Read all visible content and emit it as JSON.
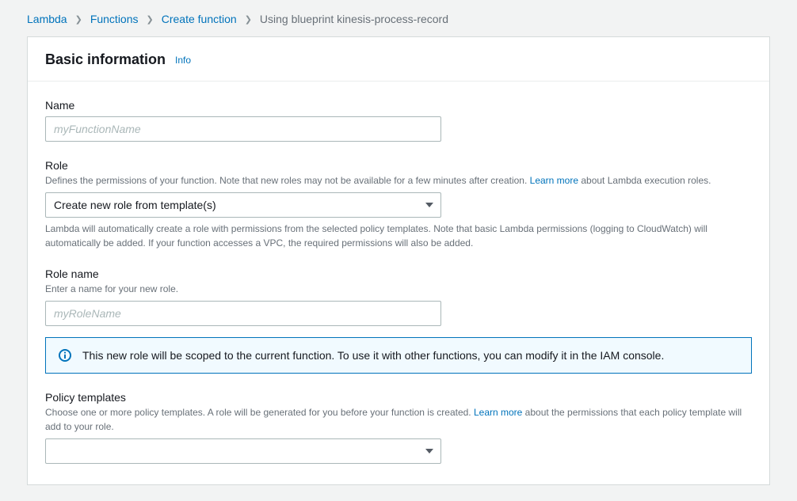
{
  "breadcrumb": {
    "items": [
      {
        "label": "Lambda"
      },
      {
        "label": "Functions"
      },
      {
        "label": "Create function"
      }
    ],
    "current": "Using blueprint kinesis-process-record"
  },
  "panel": {
    "title": "Basic information",
    "info_label": "Info"
  },
  "name_field": {
    "label": "Name",
    "placeholder": "myFunctionName",
    "value": ""
  },
  "role_field": {
    "label": "Role",
    "hint_before_link": "Defines the permissions of your function. Note that new roles may not be available for a few minutes after creation. ",
    "hint_link": "Learn more",
    "hint_after_link": " about Lambda execution roles.",
    "selected": "Create new role from template(s)",
    "help_below": "Lambda will automatically create a role with permissions from the selected policy templates. Note that basic Lambda permissions (logging to CloudWatch) will automatically be added. If your function accesses a VPC, the required permissions will also be added."
  },
  "role_name_field": {
    "label": "Role name",
    "hint": "Enter a name for your new role.",
    "placeholder": "myRoleName",
    "value": ""
  },
  "role_alert": {
    "text": "This new role will be scoped to the current function. To use it with other functions, you can modify it in the IAM console."
  },
  "policy_templates_field": {
    "label": "Policy templates",
    "hint_before_link": "Choose one or more policy templates. A role will be generated for you before your function is created. ",
    "hint_link": "Learn more",
    "hint_after_link": " about the permissions that each policy template will add to your role.",
    "selected": ""
  }
}
